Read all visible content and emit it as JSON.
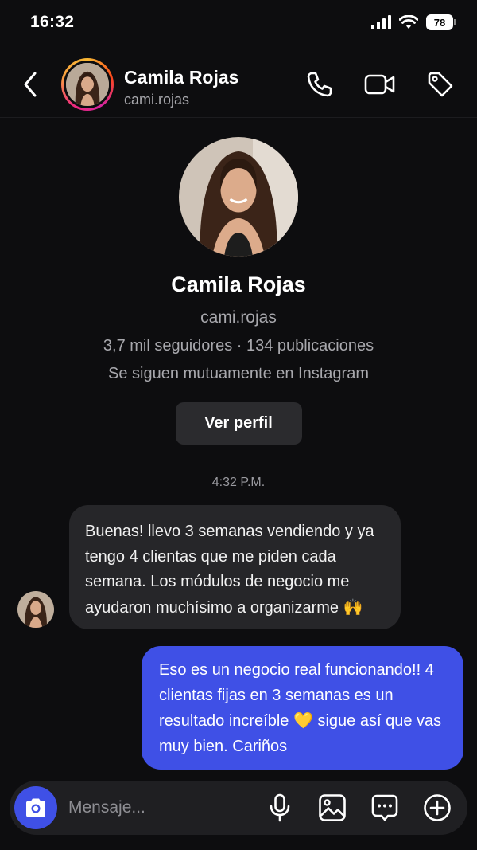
{
  "status_bar": {
    "time": "16:32",
    "battery": "78"
  },
  "header": {
    "name": "Camila Rojas",
    "username": "cami.rojas"
  },
  "profile": {
    "name": "Camila Rojas",
    "username": "cami.rojas",
    "stats": "3,7 mil seguidores · 134 publicaciones",
    "mutual": "Se siguen mutuamente en Instagram",
    "view_profile_label": "Ver perfil"
  },
  "timestamp": "4:32 P.M.",
  "messages": [
    {
      "direction": "incoming",
      "text": "Buenas! llevo 3 semanas vendiendo y ya tengo 4 clientas que me piden cada semana. Los módulos de negocio me ayudaron muchísimo a organizarme",
      "emoji": "🙌"
    },
    {
      "direction": "outgoing",
      "text_before": "Eso es un negocio real funcionando!! 4 clientas fijas en 3 semanas es un resultado increíble",
      "emoji": "💛",
      "text_after": "sigue así que vas muy bien. Cariños"
    }
  ],
  "composer": {
    "placeholder": "Mensaje..."
  },
  "icons": [
    "signal-icon",
    "wifi-icon",
    "back-icon",
    "phone-icon",
    "video-icon",
    "tag-icon",
    "camera-icon",
    "microphone-icon",
    "gallery-icon",
    "sticker-icon",
    "plus-icon"
  ],
  "colors": {
    "background": "#0d0d0f",
    "accent": "#3f50e6",
    "incoming_bubble": "#262629",
    "muted_text": "#a8a8ad"
  }
}
